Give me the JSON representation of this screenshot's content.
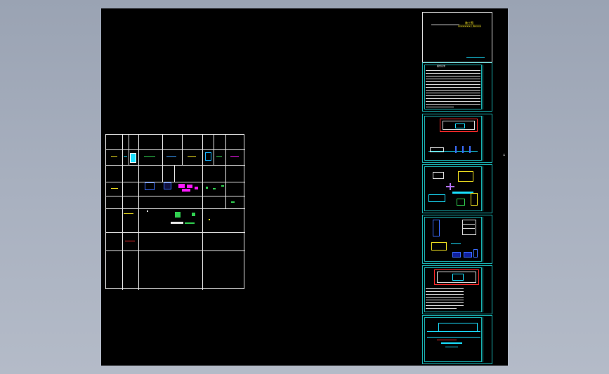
{
  "viewport": {
    "background": "#000000",
    "app_background": "#a3abba"
  },
  "cover_sheet": {
    "title_line_1": "施工图",
    "title_line_2": "某某某某某某工程某某某"
  },
  "index_sheet": {
    "header": "图纸目录"
  },
  "sheets": [
    {
      "id": "cover",
      "label": "cover sheet"
    },
    {
      "id": "index",
      "label": "drawing index"
    },
    {
      "id": "sheet-3",
      "label": "plan sheet"
    },
    {
      "id": "sheet-4",
      "label": "detail sheet"
    },
    {
      "id": "sheet-5",
      "label": "detail sheet"
    },
    {
      "id": "sheet-6",
      "label": "notes sheet"
    },
    {
      "id": "sheet-7",
      "label": "section sheet"
    }
  ],
  "colors": {
    "frame": "#19b3b3",
    "line": "#e8e8e8",
    "magenta": "#ff19ff",
    "cyan": "#19e0ff",
    "yellow": "#f0e020",
    "green": "#30d050",
    "red": "#ff2a2a",
    "blue": "#3040ff"
  }
}
